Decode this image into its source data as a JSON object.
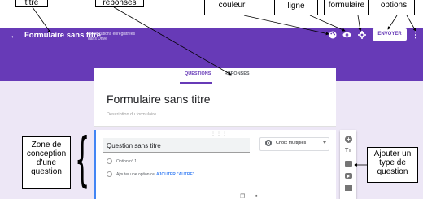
{
  "header": {
    "form_title": "Formulaire sans titre",
    "save_status": "Modifications enregistrées dans Drive",
    "send_label": "ENVOYER",
    "icons": [
      "palette-icon",
      "eye-icon",
      "gear-icon",
      "more-icon"
    ],
    "color": "#673ab7"
  },
  "tabs": [
    {
      "label": "QUESTIONS",
      "active": true
    },
    {
      "label": "RÉPONSES",
      "active": false
    }
  ],
  "form": {
    "title": "Formulaire sans titre",
    "description": "Description du formulaire"
  },
  "question": {
    "title": "Question sans titre",
    "type_label": "Choix multiples",
    "option1": "Option n° 1",
    "add_option": "Ajouter une option",
    "or_word": "ou",
    "add_other": "AJOUTER \"AUTRE\""
  },
  "callouts": {
    "titre": "titre",
    "reponses": "réponses",
    "couleur": "couleur",
    "ligne": "ligne",
    "formulaire": "formulaire",
    "options": "options",
    "zone": "Zone de conception d'une question",
    "ajouter": "Ajouter un type de question"
  },
  "add_panel": {
    "plus_glyph": "+",
    "title_glyph": "Tт",
    "icons": [
      "add-question-icon",
      "add-title-icon",
      "add-image-icon",
      "add-video-icon",
      "add-section-icon"
    ]
  },
  "colors": {
    "accent": "#673ab7",
    "background": "#ede7f6",
    "link": "#4285f4"
  }
}
